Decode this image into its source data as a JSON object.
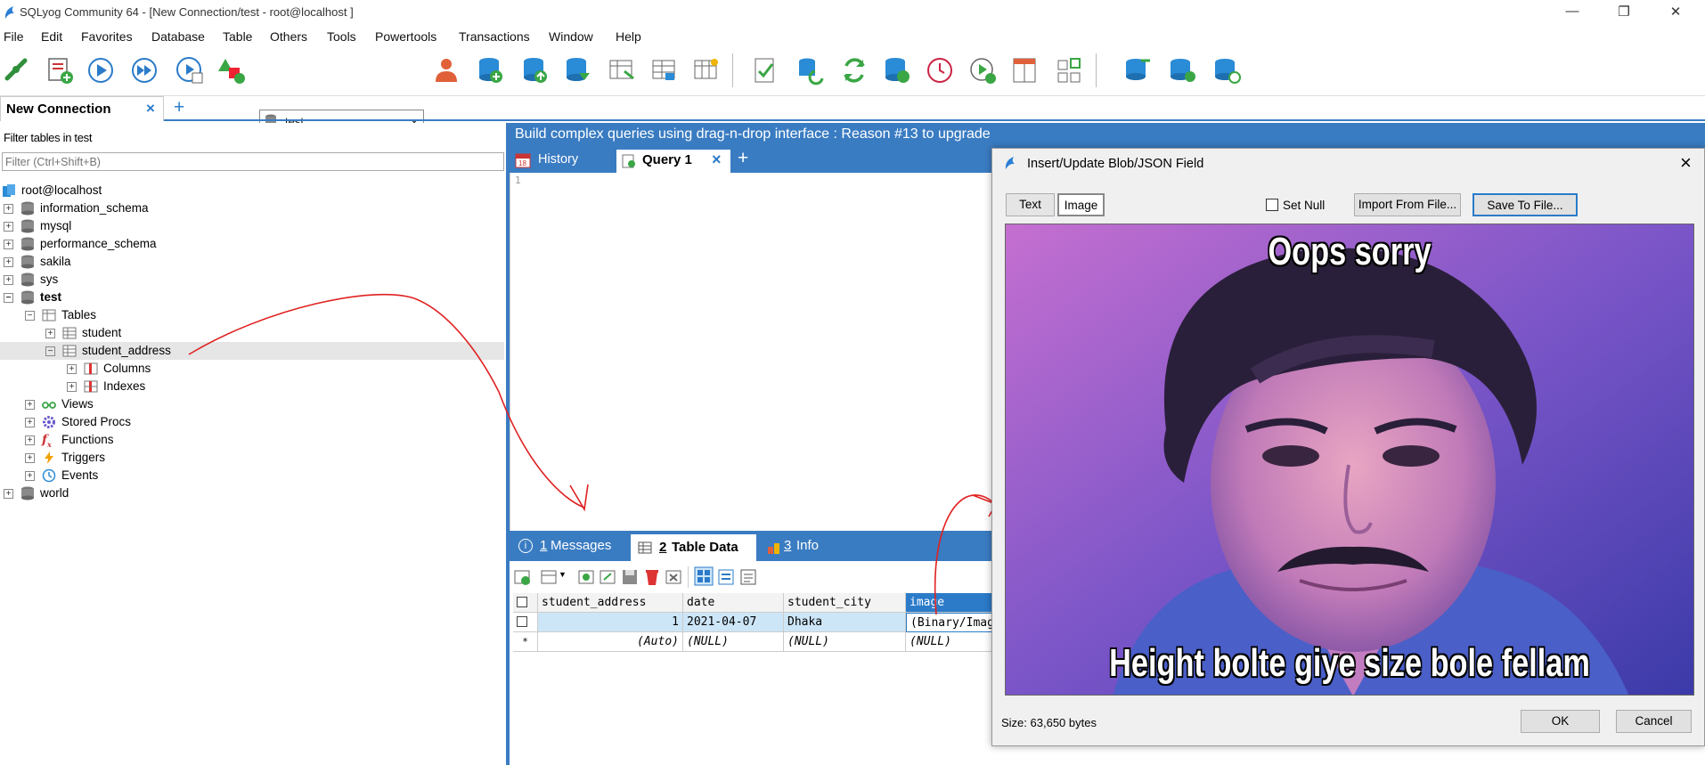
{
  "window": {
    "title": "SQLyog Community 64 - [New Connection/test - root@localhost ]"
  },
  "menu": [
    "File",
    "Edit",
    "Favorites",
    "Database",
    "Table",
    "Others",
    "Tools",
    "Powertools",
    "Transactions",
    "Window",
    "Help"
  ],
  "toolbar": {
    "db_selector": "test"
  },
  "connection_tab": {
    "label": "New Connection"
  },
  "left": {
    "filter_label": "Filter tables in test",
    "filter_placeholder": "Filter (Ctrl+Shift+B)",
    "tree": {
      "root": "root@localhost",
      "dbs": [
        "information_schema",
        "mysql",
        "performance_schema",
        "sakila",
        "sys"
      ],
      "active_db": "test",
      "tables_label": "Tables",
      "tables": [
        "student",
        "student_address"
      ],
      "children": [
        "Columns",
        "Indexes"
      ],
      "others": [
        "Views",
        "Stored Procs",
        "Functions",
        "Triggers",
        "Events"
      ],
      "last_db": "world"
    }
  },
  "banner": "Build complex queries using drag-n-drop interface : Reason #13 to upgrade",
  "query_tabs": {
    "history": "History",
    "query": "Query 1"
  },
  "editor": {
    "line1": "1"
  },
  "result_tabs": {
    "messages_num": "1",
    "messages": "Messages",
    "tabledata_num": "2",
    "tabledata": "Table Data",
    "info_num": "3",
    "info": "Info"
  },
  "grid": {
    "headers": [
      "student_address",
      "date",
      "student_city",
      "image"
    ],
    "rows": [
      [
        "1",
        "2021-04-07",
        "Dhaka",
        "(Binary/Image)"
      ],
      [
        "(Auto)",
        "(NULL)",
        "(NULL)",
        "(NULL)"
      ]
    ],
    "new_row_marker": "*"
  },
  "dialog": {
    "title": "Insert/Update Blob/JSON Field",
    "tab_text": "Text",
    "tab_image": "Image",
    "set_null": "Set Null",
    "import": "Import From File...",
    "save": "Save To File...",
    "caption_top": "Oops sorry",
    "caption_bottom": "Height bolte giye size bole fellam",
    "size": "Size: 63,650 bytes",
    "ok": "OK",
    "cancel": "Cancel"
  },
  "colors": {
    "accent": "#3a7cc2",
    "selected_row": "#cde6f7",
    "annotation": "#e02020"
  }
}
